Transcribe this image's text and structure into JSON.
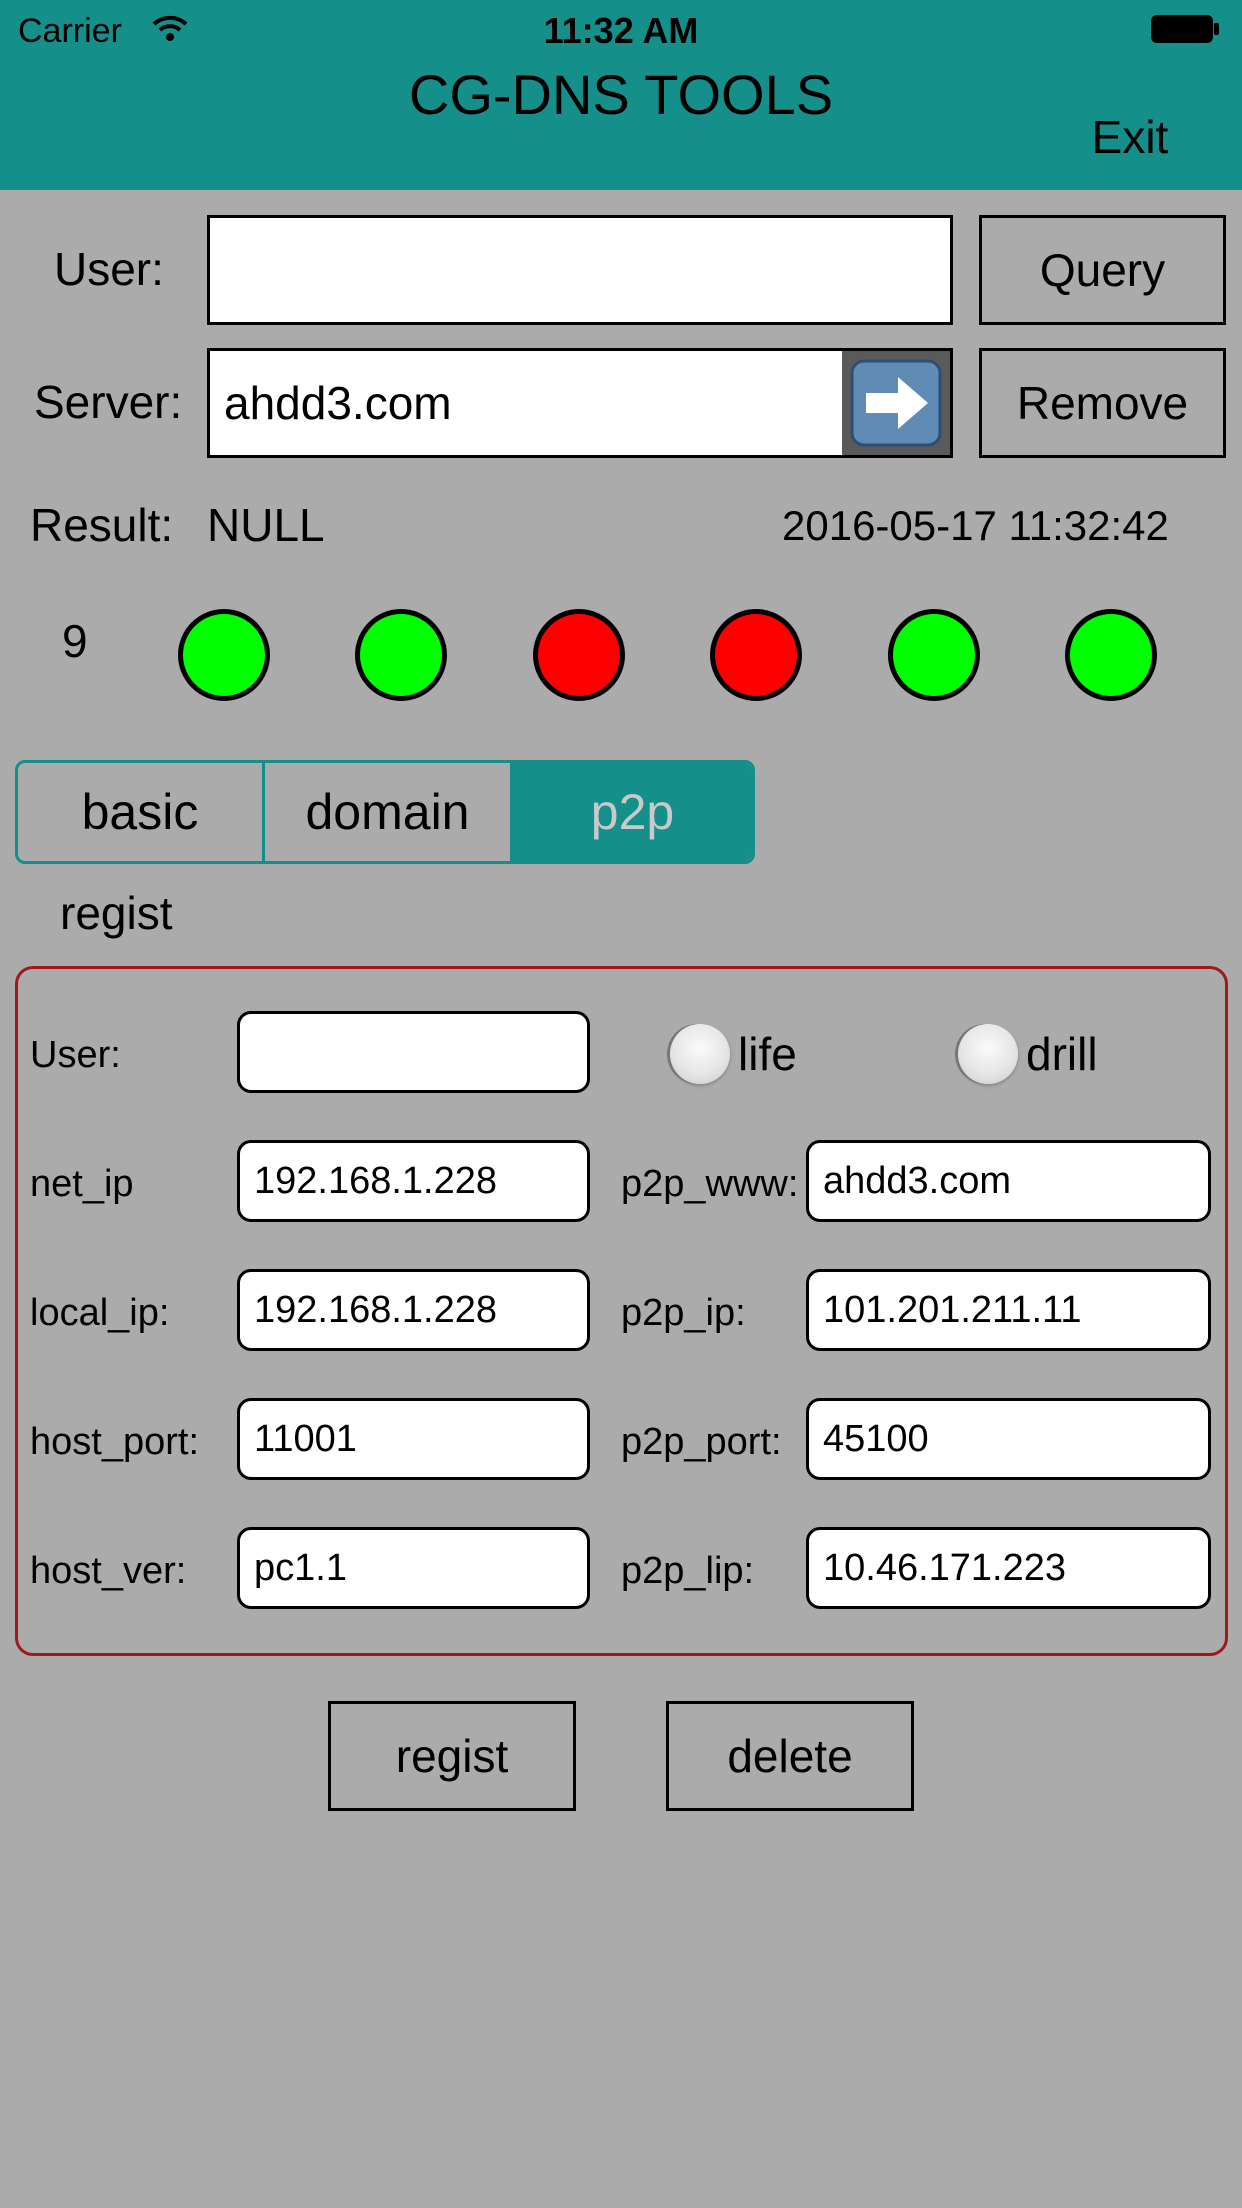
{
  "status_bar": {
    "carrier": "Carrier",
    "time": "11:32 AM"
  },
  "header": {
    "title": "CG-DNS TOOLS",
    "exit_label": "Exit"
  },
  "top_form": {
    "user_label": "User:",
    "user_value": "",
    "query_label": "Query",
    "server_label": "Server:",
    "server_value": "ahdd3.com",
    "remove_label": "Remove"
  },
  "result": {
    "label": "Result:",
    "value": "NULL",
    "timestamp": "2016-05-17 11:32:42"
  },
  "indicators": {
    "count": "9",
    "lights": [
      "green",
      "green",
      "red",
      "red",
      "green",
      "green"
    ],
    "colors": {
      "green": "#00ff00",
      "red": "#ff0000"
    }
  },
  "tabs": [
    {
      "label": "basic",
      "active": false
    },
    {
      "label": "domain",
      "active": false
    },
    {
      "label": "p2p",
      "active": true
    }
  ],
  "section_label": "regist",
  "regist_form": {
    "user_label": "User:",
    "user_value": "",
    "radio_life": "life",
    "radio_drill": "drill",
    "rows": [
      {
        "left_label": "net_ip",
        "left_value": "192.168.1.228",
        "right_label": "p2p_www:",
        "right_value": "ahdd3.com"
      },
      {
        "left_label": "local_ip:",
        "left_value": "192.168.1.228",
        "right_label": "p2p_ip:",
        "right_value": "101.201.211.11"
      },
      {
        "left_label": "host_port:",
        "left_value": "11001",
        "right_label": "p2p_port:",
        "right_value": "45100"
      },
      {
        "left_label": "host_ver:",
        "left_value": "pc1.1",
        "right_label": "p2p_lip:",
        "right_value": "10.46.171.223"
      }
    ]
  },
  "actions": {
    "regist_label": "regist",
    "delete_label": "delete"
  },
  "colors": {
    "header": "#148f8a",
    "background": "#ababab",
    "panel_border": "#a0191a"
  }
}
